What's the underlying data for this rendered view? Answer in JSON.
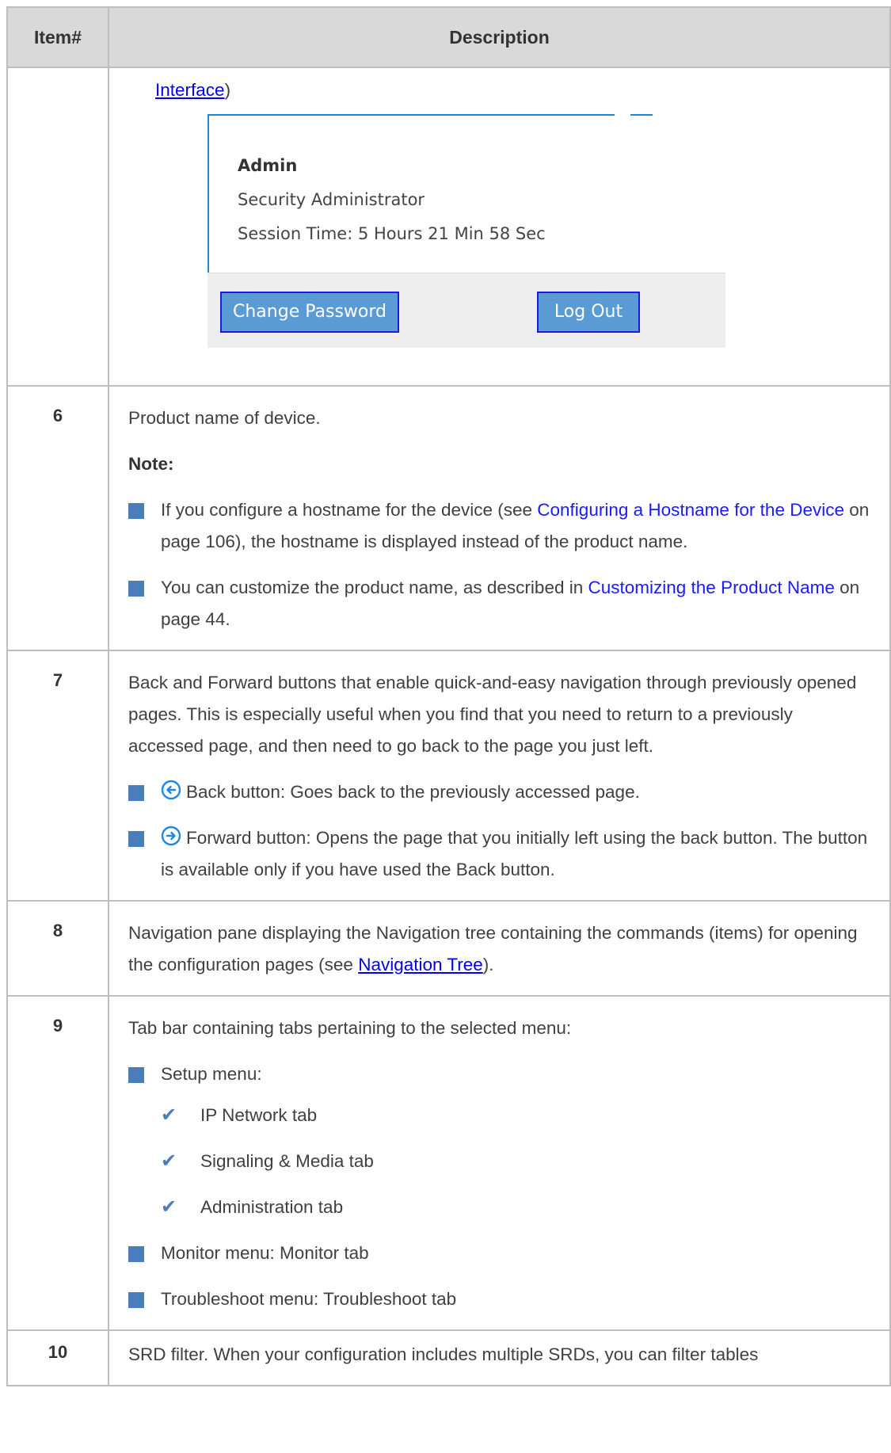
{
  "table": {
    "headers": [
      "Item#",
      "Description"
    ],
    "row5": {
      "link": "Interface",
      "after_link": ")",
      "popup": {
        "user": "Admin",
        "role": "Security Administrator",
        "session": "Session Time: 5 Hours 21 Min 58 Sec",
        "change_password": "Change Password",
        "log_out": "Log Out"
      }
    },
    "row6": {
      "num": "6",
      "text": "Product name of device.",
      "note": "Note:",
      "b1_pre": "If you configure a hostname for the device (see ",
      "b1_xref": "Configuring a Hostname for the Device",
      "b1_post": " on page 106), the hostname is displayed instead of the product name.",
      "b2_pre": "You can customize the product name, as described in ",
      "b2_xref": "Customizing the Product Name",
      "b2_post": " on page 44."
    },
    "row7": {
      "num": "7",
      "text": "Back and Forward buttons that enable quick-and-easy navigation through previously opened pages. This is especially useful when you find that you need to return to a previously accessed page, and then need to go back to the page you just left.",
      "back": "Back button: Goes back to the previously accessed page.",
      "forward": "Forward button: Opens the page that you initially left using the back button. The button is available only if you have used the Back button."
    },
    "row8": {
      "num": "8",
      "pre": "Navigation pane displaying the Navigation tree containing the commands (items) for opening the configuration pages (see ",
      "link": "Navigation Tree",
      "post": ")."
    },
    "row9": {
      "num": "9",
      "text": "Tab bar containing tabs pertaining to the selected menu:",
      "setup": "Setup menu:",
      "tabs": [
        "IP Network tab",
        "Signaling & Media tab",
        "Administration tab"
      ],
      "monitor": "Monitor menu: Monitor tab",
      "troubleshoot": "Troubleshoot menu: Troubleshoot tab"
    },
    "row10": {
      "num": "10",
      "text": "SRD filter. When your configuration includes multiple SRDs, you can filter tables"
    }
  },
  "colors": {
    "bullet": "#4a7ebb",
    "header_bg": "#d9d9d9",
    "button": "#5b9bd5",
    "link": "#0000ee"
  }
}
